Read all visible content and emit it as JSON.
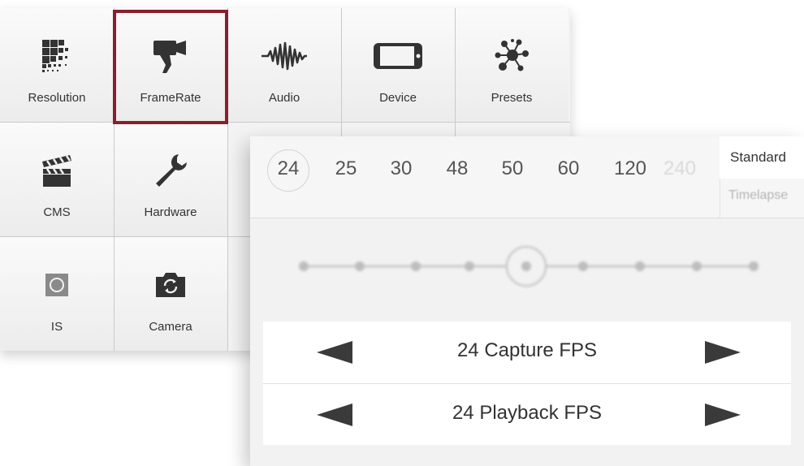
{
  "menu": {
    "items": [
      {
        "label": "Resolution",
        "icon": "resolution-grid-icon"
      },
      {
        "label": "FrameRate",
        "icon": "video-camera-icon",
        "selected": true
      },
      {
        "label": "Audio",
        "icon": "audio-waveform-icon"
      },
      {
        "label": "Device",
        "icon": "phone-device-icon"
      },
      {
        "label": "Presets",
        "icon": "presets-molecule-icon"
      },
      {
        "label": "CMS",
        "icon": "clapperboard-icon"
      },
      {
        "label": "Hardware",
        "icon": "wrench-icon"
      },
      {
        "label": "IS",
        "icon": "image-stabilization-icon"
      },
      {
        "label": "Camera",
        "icon": "camera-switch-icon"
      }
    ],
    "accent_color": "#8b1e2d"
  },
  "framerate": {
    "options": [
      "24",
      "25",
      "30",
      "48",
      "50",
      "60",
      "120",
      "240"
    ],
    "selected": "24",
    "modes": {
      "standard": "Standard",
      "timelapse": "Timelapse"
    },
    "capture_label": "24 Capture FPS",
    "playback_label": "24 Playback FPS"
  }
}
